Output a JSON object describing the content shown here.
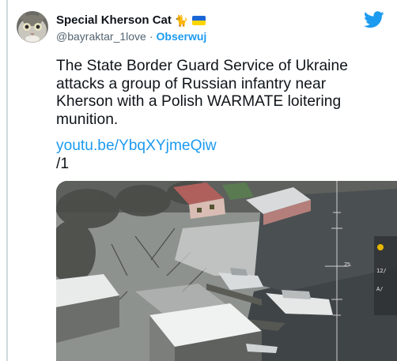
{
  "tweet": {
    "display_name": "Special Kherson Cat",
    "name_emoji": "🐈",
    "handle": "@bayraktar_1love",
    "separator": "·",
    "follow_label": "Obserwuj",
    "text_lines": [
      "The State Border Guard Service of Ukraine",
      "attacks a group of Russian infantry near",
      "Kherson with a Polish WARMATE loitering",
      "munition."
    ],
    "link": "youtu.be/YbqXYjmeQiw",
    "suffix": "/1"
  },
  "video_overlay": {
    "reticle_value": "2%",
    "side_labels": [
      "12/",
      "A/"
    ]
  },
  "colors": {
    "accent": "#1d9bf0",
    "text": "#0f1419",
    "muted": "#536471",
    "flag_blue": "#1a66d6",
    "flag_yellow": "#ffd500"
  },
  "icons": {
    "logo": "twitter-bird-icon",
    "flag": "ukraine-flag-icon"
  }
}
